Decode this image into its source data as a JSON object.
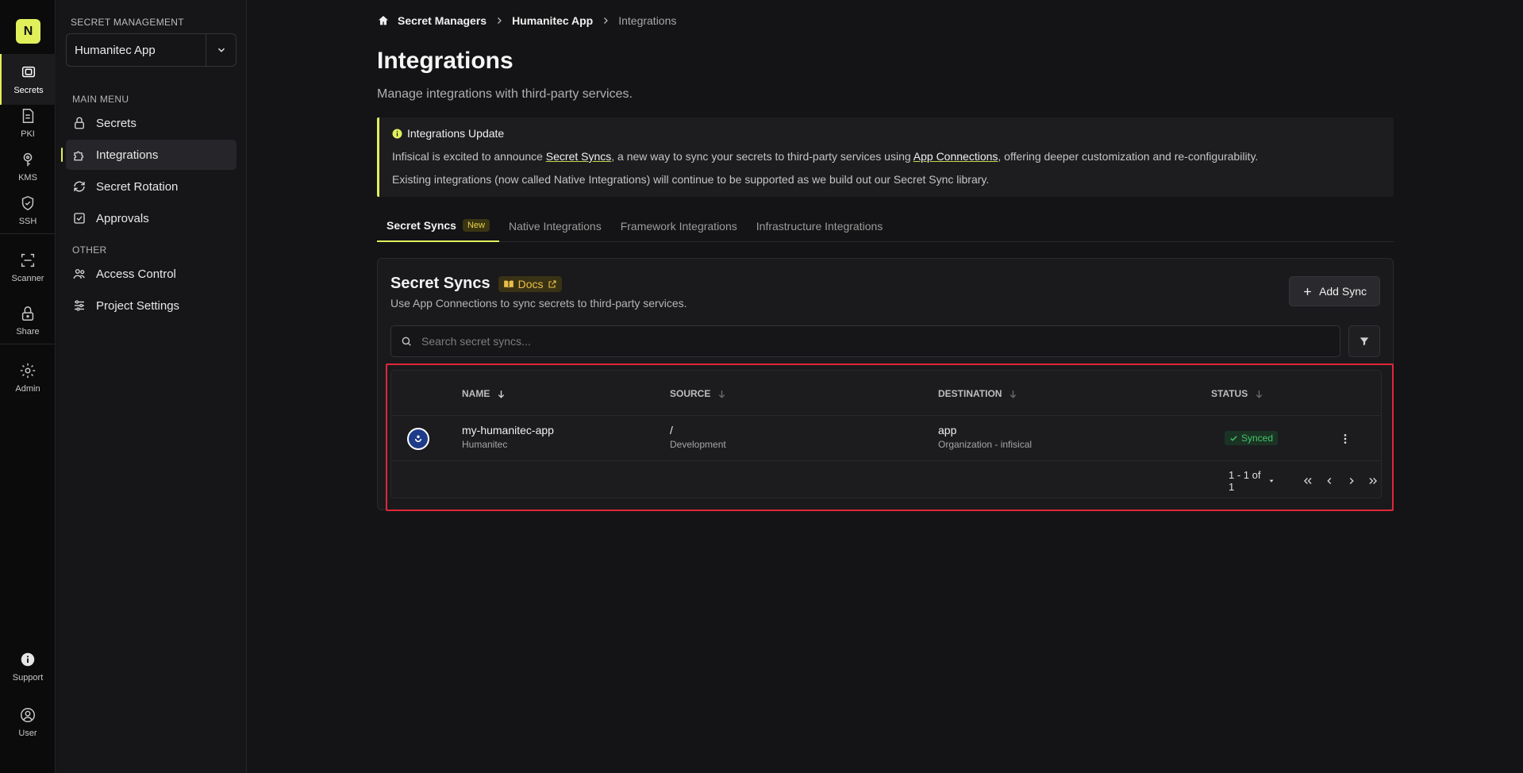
{
  "org": {
    "initial": "N"
  },
  "rail": {
    "items": [
      {
        "label": "Secrets",
        "icon": "vault-icon"
      },
      {
        "label": "PKI",
        "icon": "certificate-icon"
      },
      {
        "label": "KMS",
        "icon": "key-icon"
      },
      {
        "label": "SSH",
        "icon": "shield-icon"
      },
      {
        "label": "Scanner",
        "icon": "scan-icon"
      },
      {
        "label": "Share",
        "icon": "lock-icon"
      },
      {
        "label": "Admin",
        "icon": "gear-icon"
      }
    ],
    "support": "Support",
    "user": "User"
  },
  "sidebar": {
    "title": "SECRET MANAGEMENT",
    "app_select": "Humanitec App",
    "main_menu_label": "MAIN MENU",
    "main_items": [
      "Secrets",
      "Integrations",
      "Secret Rotation",
      "Approvals"
    ],
    "other_label": "OTHER",
    "other_items": [
      "Access Control",
      "Project Settings"
    ]
  },
  "breadcrumb": [
    "Secret Managers",
    "Humanitec App",
    "Integrations"
  ],
  "page": {
    "title": "Integrations",
    "subtitle": "Manage integrations with third-party services."
  },
  "notice": {
    "title": "Integrations Update",
    "line1_a": "Infisical is excited to announce ",
    "line1_link1": "Secret Syncs",
    "line1_b": ", a new way to sync your secrets to third-party services using ",
    "line1_link2": "App Connections",
    "line1_c": ", offering deeper customization and re-configurability.",
    "line2": "Existing integrations (now called Native Integrations) will continue to be supported as we build out our Secret Sync library."
  },
  "tabs": {
    "active": "Secret Syncs",
    "active_badge": "New",
    "others": [
      "Native Integrations",
      "Framework Integrations",
      "Infrastructure Integrations"
    ]
  },
  "card": {
    "title": "Secret Syncs",
    "docs": "Docs",
    "subtitle": "Use App Connections to sync secrets to third-party services.",
    "add_button": "Add Sync",
    "search_placeholder": "Search secret syncs..."
  },
  "table": {
    "columns": [
      "NAME",
      "SOURCE",
      "DESTINATION",
      "STATUS"
    ],
    "rows": [
      {
        "name": "my-humanitec-app",
        "name_sub": "Humanitec",
        "source": "/",
        "source_sub": "Development",
        "destination": "app",
        "destination_sub": "Organization - infisical",
        "status": "Synced"
      }
    ],
    "pagination": "1 - 1 of 1"
  },
  "colors": {
    "accent": "#e1f05a",
    "highlight": "#e0263a",
    "synced": "#45c46a"
  }
}
